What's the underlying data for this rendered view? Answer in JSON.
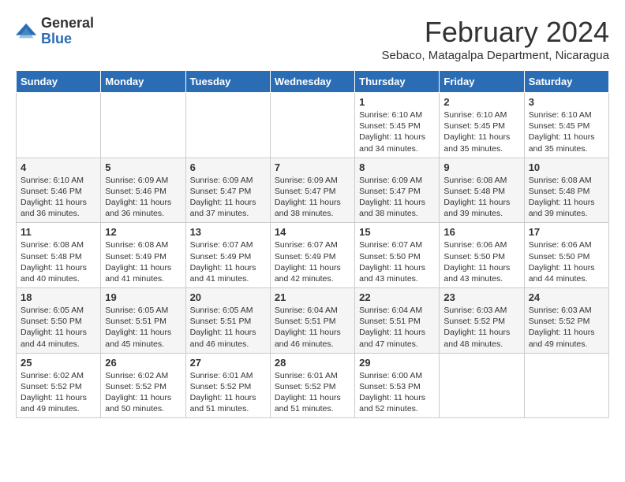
{
  "logo": {
    "general": "General",
    "blue": "Blue"
  },
  "header": {
    "month": "February 2024",
    "location": "Sebaco, Matagalpa Department, Nicaragua"
  },
  "weekdays": [
    "Sunday",
    "Monday",
    "Tuesday",
    "Wednesday",
    "Thursday",
    "Friday",
    "Saturday"
  ],
  "weeks": [
    [
      {
        "day": "",
        "info": ""
      },
      {
        "day": "",
        "info": ""
      },
      {
        "day": "",
        "info": ""
      },
      {
        "day": "",
        "info": ""
      },
      {
        "day": "1",
        "info": "Sunrise: 6:10 AM\nSunset: 5:45 PM\nDaylight: 11 hours\nand 34 minutes."
      },
      {
        "day": "2",
        "info": "Sunrise: 6:10 AM\nSunset: 5:45 PM\nDaylight: 11 hours\nand 35 minutes."
      },
      {
        "day": "3",
        "info": "Sunrise: 6:10 AM\nSunset: 5:45 PM\nDaylight: 11 hours\nand 35 minutes."
      }
    ],
    [
      {
        "day": "4",
        "info": "Sunrise: 6:10 AM\nSunset: 5:46 PM\nDaylight: 11 hours\nand 36 minutes."
      },
      {
        "day": "5",
        "info": "Sunrise: 6:09 AM\nSunset: 5:46 PM\nDaylight: 11 hours\nand 36 minutes."
      },
      {
        "day": "6",
        "info": "Sunrise: 6:09 AM\nSunset: 5:47 PM\nDaylight: 11 hours\nand 37 minutes."
      },
      {
        "day": "7",
        "info": "Sunrise: 6:09 AM\nSunset: 5:47 PM\nDaylight: 11 hours\nand 38 minutes."
      },
      {
        "day": "8",
        "info": "Sunrise: 6:09 AM\nSunset: 5:47 PM\nDaylight: 11 hours\nand 38 minutes."
      },
      {
        "day": "9",
        "info": "Sunrise: 6:08 AM\nSunset: 5:48 PM\nDaylight: 11 hours\nand 39 minutes."
      },
      {
        "day": "10",
        "info": "Sunrise: 6:08 AM\nSunset: 5:48 PM\nDaylight: 11 hours\nand 39 minutes."
      }
    ],
    [
      {
        "day": "11",
        "info": "Sunrise: 6:08 AM\nSunset: 5:48 PM\nDaylight: 11 hours\nand 40 minutes."
      },
      {
        "day": "12",
        "info": "Sunrise: 6:08 AM\nSunset: 5:49 PM\nDaylight: 11 hours\nand 41 minutes."
      },
      {
        "day": "13",
        "info": "Sunrise: 6:07 AM\nSunset: 5:49 PM\nDaylight: 11 hours\nand 41 minutes."
      },
      {
        "day": "14",
        "info": "Sunrise: 6:07 AM\nSunset: 5:49 PM\nDaylight: 11 hours\nand 42 minutes."
      },
      {
        "day": "15",
        "info": "Sunrise: 6:07 AM\nSunset: 5:50 PM\nDaylight: 11 hours\nand 43 minutes."
      },
      {
        "day": "16",
        "info": "Sunrise: 6:06 AM\nSunset: 5:50 PM\nDaylight: 11 hours\nand 43 minutes."
      },
      {
        "day": "17",
        "info": "Sunrise: 6:06 AM\nSunset: 5:50 PM\nDaylight: 11 hours\nand 44 minutes."
      }
    ],
    [
      {
        "day": "18",
        "info": "Sunrise: 6:05 AM\nSunset: 5:50 PM\nDaylight: 11 hours\nand 44 minutes."
      },
      {
        "day": "19",
        "info": "Sunrise: 6:05 AM\nSunset: 5:51 PM\nDaylight: 11 hours\nand 45 minutes."
      },
      {
        "day": "20",
        "info": "Sunrise: 6:05 AM\nSunset: 5:51 PM\nDaylight: 11 hours\nand 46 minutes."
      },
      {
        "day": "21",
        "info": "Sunrise: 6:04 AM\nSunset: 5:51 PM\nDaylight: 11 hours\nand 46 minutes."
      },
      {
        "day": "22",
        "info": "Sunrise: 6:04 AM\nSunset: 5:51 PM\nDaylight: 11 hours\nand 47 minutes."
      },
      {
        "day": "23",
        "info": "Sunrise: 6:03 AM\nSunset: 5:52 PM\nDaylight: 11 hours\nand 48 minutes."
      },
      {
        "day": "24",
        "info": "Sunrise: 6:03 AM\nSunset: 5:52 PM\nDaylight: 11 hours\nand 49 minutes."
      }
    ],
    [
      {
        "day": "25",
        "info": "Sunrise: 6:02 AM\nSunset: 5:52 PM\nDaylight: 11 hours\nand 49 minutes."
      },
      {
        "day": "26",
        "info": "Sunrise: 6:02 AM\nSunset: 5:52 PM\nDaylight: 11 hours\nand 50 minutes."
      },
      {
        "day": "27",
        "info": "Sunrise: 6:01 AM\nSunset: 5:52 PM\nDaylight: 11 hours\nand 51 minutes."
      },
      {
        "day": "28",
        "info": "Sunrise: 6:01 AM\nSunset: 5:52 PM\nDaylight: 11 hours\nand 51 minutes."
      },
      {
        "day": "29",
        "info": "Sunrise: 6:00 AM\nSunset: 5:53 PM\nDaylight: 11 hours\nand 52 minutes."
      },
      {
        "day": "",
        "info": ""
      },
      {
        "day": "",
        "info": ""
      }
    ]
  ]
}
